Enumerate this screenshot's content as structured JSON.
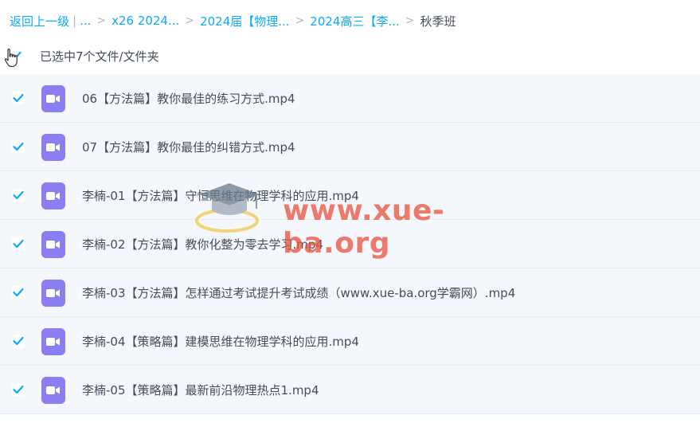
{
  "breadcrumb": {
    "back": "返回上一级",
    "ellipsis": "...",
    "items": [
      "x26 2024...",
      "2024届【物理...",
      "2024高三【李...",
      "秋季班"
    ]
  },
  "selection": {
    "label": "已选中7个文件/文件夹",
    "checked": true
  },
  "files": [
    {
      "name": "06【方法篇】教你最佳的练习方式.mp4",
      "checked": true
    },
    {
      "name": "07【方法篇】教你最佳的纠错方式.mp4",
      "checked": true
    },
    {
      "name": "李楠-01【方法篇】守恒思维在物理学科的应用.mp4",
      "checked": true
    },
    {
      "name": "李楠-02【方法篇】教你化整为零去学习.mp4",
      "checked": true
    },
    {
      "name": "李楠-03【方法篇】怎样通过考试提升考试成绩（www.xue-ba.org学霸网）.mp4",
      "checked": true
    },
    {
      "name": "李楠-04【策略篇】建模思维在物理学科的应用.mp4",
      "checked": true
    },
    {
      "name": "李楠-05【策略篇】最新前沿物理热点1.mp4",
      "checked": true
    }
  ],
  "watermark": {
    "text": "www.xue-ba.org"
  },
  "colors": {
    "accent": "#09aaff",
    "file_icon": "#8a7ef3",
    "row_bg": "#f4f8fc"
  },
  "icons": {
    "file": "video-file-icon",
    "check": "checkbox-checked-icon",
    "cursor": "hand-cursor-icon"
  }
}
